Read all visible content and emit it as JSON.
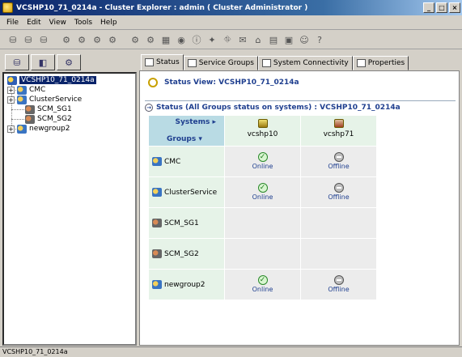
{
  "window": {
    "title": "VCSHP10_71_0214a - Cluster Explorer : admin ( Cluster Administrator )",
    "controls": [
      "_",
      "□",
      "×"
    ]
  },
  "menu": [
    "File",
    "Edit",
    "View",
    "Tools",
    "Help"
  ],
  "toolbar_icons": [
    "cluster-icon",
    "group-add-icon",
    "group-icon",
    "system-icon",
    "resource-icon",
    "resource-add-icon",
    "service-icon",
    "import-icon",
    "wizard-icon",
    "query-icon",
    "grid-icon",
    "help-circle-icon",
    "info-icon",
    "magic-wand-icon",
    "network-icon",
    "notify-icon",
    "log-icon",
    "chart-icon",
    "report-icon",
    "user-icon",
    "help-icon"
  ],
  "left_tabs": [
    "cluster-tab-icon",
    "service-tab-icon",
    "system-tab-icon"
  ],
  "tree": {
    "root": "VCSHP10_71_0214a",
    "items": [
      "CMC",
      "ClusterService",
      "SCM_SG1",
      "SCM_SG2",
      "newgroup2"
    ]
  },
  "right_tabs": [
    "Status",
    "Service Groups",
    "System Connectivity",
    "Properties"
  ],
  "status_view": {
    "title": "Status View: VCSHP10_71_0214a",
    "section": "Status (All Groups status on systems) : VCSHP10_71_0214a"
  },
  "grid": {
    "systems_label": "Systems ▸",
    "groups_label": "Groups ▾",
    "systems": [
      "vcshp10",
      "vcshp71"
    ],
    "rows": [
      {
        "group": "CMC",
        "states": [
          "Online",
          "Offline"
        ]
      },
      {
        "group": "ClusterService",
        "states": [
          "Online",
          "Offline"
        ]
      },
      {
        "group": "SCM_SG1",
        "states": [
          "",
          ""
        ]
      },
      {
        "group": "SCM_SG2",
        "states": [
          "",
          ""
        ]
      },
      {
        "group": "newgroup2",
        "states": [
          "Online",
          "Offline"
        ]
      }
    ]
  },
  "statusbar": "VCSHP10_71_0214a"
}
